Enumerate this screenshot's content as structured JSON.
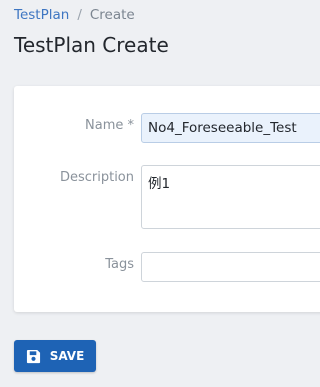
{
  "breadcrumb": {
    "parent": "TestPlan",
    "separator": "/",
    "current": "Create"
  },
  "page": {
    "title": "TestPlan Create"
  },
  "form": {
    "name": {
      "label": "Name *",
      "value": "No4_Foreseeable_Test"
    },
    "description": {
      "label": "Description",
      "value": "例1"
    },
    "tags": {
      "label": "Tags",
      "value": ""
    }
  },
  "actions": {
    "save_label": "SAVE",
    "save_icon": "floppy-disk-icon"
  },
  "colors": {
    "background": "#eef0f3",
    "link": "#3e76c2",
    "primary_button": "#1e63b5",
    "autofill_input": "#eaf2fc"
  }
}
